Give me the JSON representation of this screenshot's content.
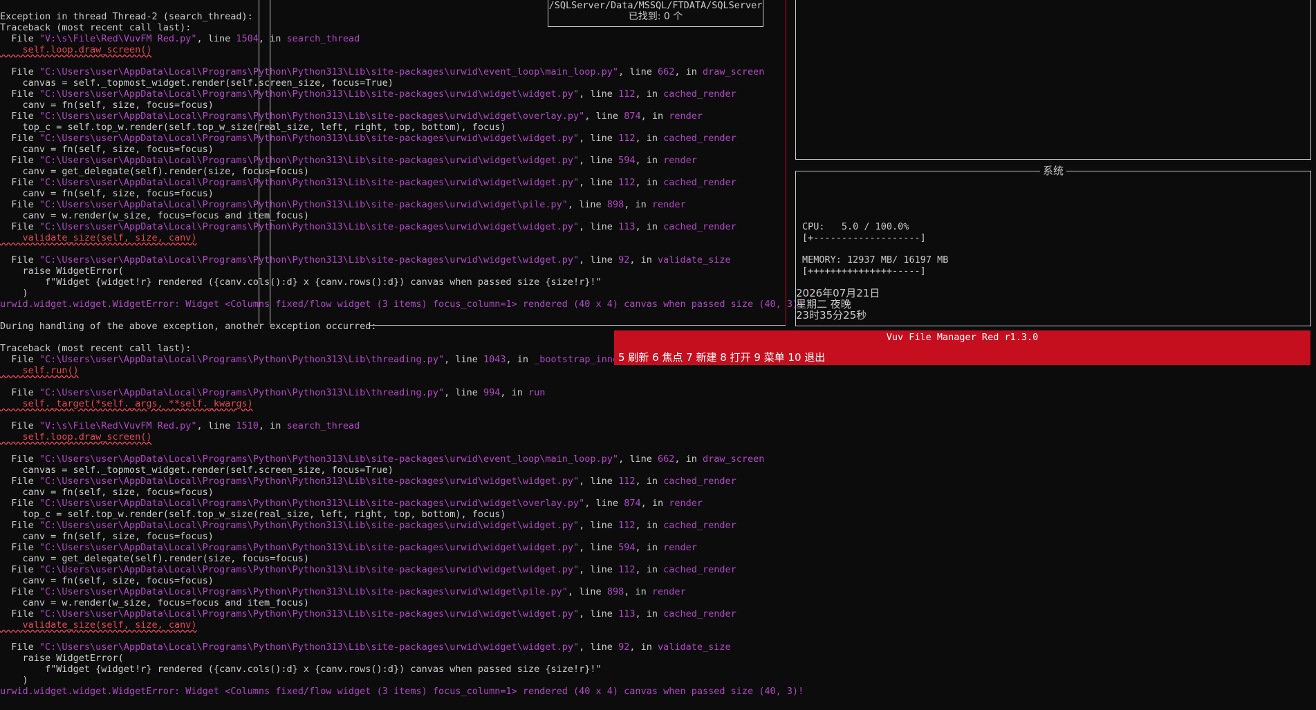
{
  "search": {
    "path": "/SQLServer/Data/MSSQL/FTDATA/SQLServer",
    "found": "已找到: 0 个"
  },
  "system_panel": {
    "title": "系统",
    "cpu_label": "CPU:",
    "cpu_value": "5.0 / 100.0%",
    "cpu_bar": "[+-------------------]",
    "memory_label": "MEMORY:",
    "memory_value": "12937 MB/ 16197 MB",
    "memory_bar": "[+++++++++++++++-----]",
    "cpu_fraction": 0.05,
    "memory_fraction": 0.7987,
    "date": "2026年07月21日",
    "weekday": "星期二 夜晚",
    "time": "23时35分25秒"
  },
  "app_bar": {
    "title": "Vuv File Manager Red r1.3.0",
    "shortcuts": "5 刷新 6 焦点 7 新建 8 打开 9 菜单 10 退出"
  },
  "traceback": {
    "header": "Exception in thread Thread-2 (search_thread):",
    "tb_label": "Traceback (most recent call last):",
    "during": "During handling of the above exception, another exception occurred:",
    "error_type": "urwid.widget.widget.WidgetError:",
    "error_msg": " Widget <Columns fixed/flow widget (3 items) focus_column=1> rendered (40 x 4) canvas when passed size (40, 3)!",
    "file_kw": "  File ",
    "line_kw": ", line ",
    "in_kw": ", in ",
    "block1": [
      {
        "path": "\"V:\\s\\File\\Red\\VuvFM Red.py\"",
        "line": "1504",
        "fn": "search_thread",
        "code": "    self.loop.draw_screen()",
        "hl": true,
        "gap": true
      },
      {
        "path": "\"C:\\Users\\user\\AppData\\Local\\Programs\\Python\\Python313\\Lib\\site-packages\\urwid\\event_loop\\main_loop.py\"",
        "line": "662",
        "fn": "draw_screen",
        "code": "    canvas = self._topmost_widget.render(self.screen_size, focus=True)",
        "hl": false,
        "gap": false
      },
      {
        "path": "\"C:\\Users\\user\\AppData\\Local\\Programs\\Python\\Python313\\Lib\\site-packages\\urwid\\widget\\widget.py\"",
        "line": "112",
        "fn": "cached_render",
        "code": "    canv = fn(self, size, focus=focus)",
        "hl": false,
        "gap": false
      },
      {
        "path": "\"C:\\Users\\user\\AppData\\Local\\Programs\\Python\\Python313\\Lib\\site-packages\\urwid\\widget\\overlay.py\"",
        "line": "874",
        "fn": "render",
        "code": "    top_c = self.top_w.render(self.top_w_size(real_size, left, right, top, bottom), focus)",
        "hl": false,
        "gap": false
      },
      {
        "path": "\"C:\\Users\\user\\AppData\\Local\\Programs\\Python\\Python313\\Lib\\site-packages\\urwid\\widget\\widget.py\"",
        "line": "112",
        "fn": "cached_render",
        "code": "    canv = fn(self, size, focus=focus)",
        "hl": false,
        "gap": false
      },
      {
        "path": "\"C:\\Users\\user\\AppData\\Local\\Programs\\Python\\Python313\\Lib\\site-packages\\urwid\\widget\\widget.py\"",
        "line": "594",
        "fn": "render",
        "code": "    canv = get_delegate(self).render(size, focus=focus)",
        "hl": false,
        "gap": false
      },
      {
        "path": "\"C:\\Users\\user\\AppData\\Local\\Programs\\Python\\Python313\\Lib\\site-packages\\urwid\\widget\\widget.py\"",
        "line": "112",
        "fn": "cached_render",
        "code": "    canv = fn(self, size, focus=focus)",
        "hl": false,
        "gap": false
      },
      {
        "path": "\"C:\\Users\\user\\AppData\\Local\\Programs\\Python\\Python313\\Lib\\site-packages\\urwid\\widget\\pile.py\"",
        "line": "898",
        "fn": "render",
        "code": "    canv = w.render(w_size, focus=focus and item_focus)",
        "hl": false,
        "gap": false
      },
      {
        "path": "\"C:\\Users\\user\\AppData\\Local\\Programs\\Python\\Python313\\Lib\\site-packages\\urwid\\widget\\widget.py\"",
        "line": "113",
        "fn": "cached_render",
        "code": "    validate_size(self, size, canv)",
        "hl": true,
        "gap": true
      },
      {
        "path": "\"C:\\Users\\user\\AppData\\Local\\Programs\\Python\\Python313\\Lib\\site-packages\\urwid\\widget\\widget.py\"",
        "line": "92",
        "fn": "validate_size",
        "code": "    raise WidgetError(",
        "hl": false,
        "gap": false,
        "extra": [
          "        f\"Widget {widget!r} rendered ({canv.cols():d} x {canv.rows():d}) canvas when passed size {size!r}!\"",
          "    )"
        ]
      }
    ],
    "block2": [
      {
        "path": "\"C:\\Users\\user\\AppData\\Local\\Programs\\Python\\Python313\\Lib\\threading.py\"",
        "line": "1043",
        "fn": "_bootstrap_inner",
        "code": "    self.run()",
        "hl": true,
        "gap": true
      },
      {
        "path": "\"C:\\Users\\user\\AppData\\Local\\Programs\\Python\\Python313\\Lib\\threading.py\"",
        "line": "994",
        "fn": "run",
        "code": "    self._target(*self._args, **self._kwargs)",
        "hl": true,
        "gap": true
      },
      {
        "path": "\"V:\\s\\File\\Red\\VuvFM Red.py\"",
        "line": "1510",
        "fn": "search_thread",
        "code": "    self.loop.draw_screen()",
        "hl": true,
        "gap": true
      },
      {
        "path": "\"C:\\Users\\user\\AppData\\Local\\Programs\\Python\\Python313\\Lib\\site-packages\\urwid\\event_loop\\main_loop.py\"",
        "line": "662",
        "fn": "draw_screen",
        "code": "    canvas = self._topmost_widget.render(self.screen_size, focus=True)",
        "hl": false,
        "gap": false
      },
      {
        "path": "\"C:\\Users\\user\\AppData\\Local\\Programs\\Python\\Python313\\Lib\\site-packages\\urwid\\widget\\widget.py\"",
        "line": "112",
        "fn": "cached_render",
        "code": "    canv = fn(self, size, focus=focus)",
        "hl": false,
        "gap": false
      },
      {
        "path": "\"C:\\Users\\user\\AppData\\Local\\Programs\\Python\\Python313\\Lib\\site-packages\\urwid\\widget\\overlay.py\"",
        "line": "874",
        "fn": "render",
        "code": "    top_c = self.top_w.render(self.top_w_size(real_size, left, right, top, bottom), focus)",
        "hl": false,
        "gap": false
      },
      {
        "path": "\"C:\\Users\\user\\AppData\\Local\\Programs\\Python\\Python313\\Lib\\site-packages\\urwid\\widget\\widget.py\"",
        "line": "112",
        "fn": "cached_render",
        "code": "    canv = fn(self, size, focus=focus)",
        "hl": false,
        "gap": false
      },
      {
        "path": "\"C:\\Users\\user\\AppData\\Local\\Programs\\Python\\Python313\\Lib\\site-packages\\urwid\\widget\\widget.py\"",
        "line": "594",
        "fn": "render",
        "code": "    canv = get_delegate(self).render(size, focus=focus)",
        "hl": false,
        "gap": false
      },
      {
        "path": "\"C:\\Users\\user\\AppData\\Local\\Programs\\Python\\Python313\\Lib\\site-packages\\urwid\\widget\\widget.py\"",
        "line": "112",
        "fn": "cached_render",
        "code": "    canv = fn(self, size, focus=focus)",
        "hl": false,
        "gap": false
      },
      {
        "path": "\"C:\\Users\\user\\AppData\\Local\\Programs\\Python\\Python313\\Lib\\site-packages\\urwid\\widget\\pile.py\"",
        "line": "898",
        "fn": "render",
        "code": "    canv = w.render(w_size, focus=focus and item_focus)",
        "hl": false,
        "gap": false
      },
      {
        "path": "\"C:\\Users\\user\\AppData\\Local\\Programs\\Python\\Python313\\Lib\\site-packages\\urwid\\widget\\widget.py\"",
        "line": "113",
        "fn": "cached_render",
        "code": "    validate_size(self, size, canv)",
        "hl": true,
        "gap": true
      },
      {
        "path": "\"C:\\Users\\user\\AppData\\Local\\Programs\\Python\\Python313\\Lib\\site-packages\\urwid\\widget\\widget.py\"",
        "line": "92",
        "fn": "validate_size",
        "code": "    raise WidgetError(",
        "hl": false,
        "gap": false,
        "extra": [
          "        f\"Widget {widget!r} rendered ({canv.cols():d} x {canv.rows():d}) canvas when passed size {size!r}!\"",
          "    )"
        ]
      }
    ]
  }
}
